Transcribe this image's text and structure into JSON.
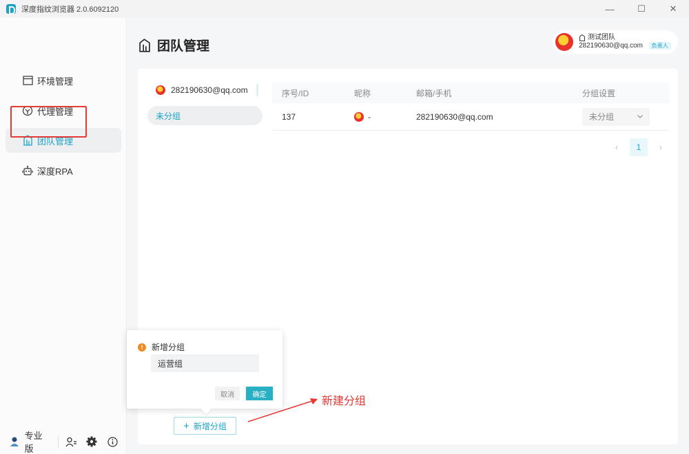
{
  "window": {
    "title": "深度指纹浏览器 2.0.6092120",
    "controls": [
      "—",
      "☐",
      "✕"
    ]
  },
  "sidebar": {
    "items": [
      {
        "label": "环境管理",
        "icon": "browser-window-icon"
      },
      {
        "label": "代理管理",
        "icon": "proxy-icon"
      },
      {
        "label": "团队管理",
        "icon": "team-building-icon",
        "active": true
      },
      {
        "label": "深度RPA",
        "icon": "robot-icon"
      }
    ],
    "edition": "专业版"
  },
  "header": {
    "title": "团队管理",
    "user": {
      "team": "测试团队",
      "email": "282190630@qq.com",
      "role_tag": "负责人"
    }
  },
  "groups": {
    "owner": "282190630@qq.com",
    "items": [
      {
        "label": "未分组",
        "active": true
      }
    ]
  },
  "table": {
    "columns": [
      "序号/ID",
      "昵称",
      "邮箱/手机",
      "分组设置"
    ],
    "rows": [
      {
        "id": "137",
        "nickname": "-",
        "email": "282190630@qq.com",
        "group": "未分组"
      }
    ]
  },
  "pagination": {
    "current": "1",
    "prev": "‹",
    "next": "›"
  },
  "popover": {
    "title": "新增分组",
    "input_value": "运营组",
    "cancel": "取消",
    "confirm": "确定"
  },
  "add_group_button": "新增分组",
  "annotation": "新建分组",
  "colors": {
    "accent": "#1aa3c9",
    "annotation": "#e53935",
    "confirm": "#2ab0c5"
  }
}
